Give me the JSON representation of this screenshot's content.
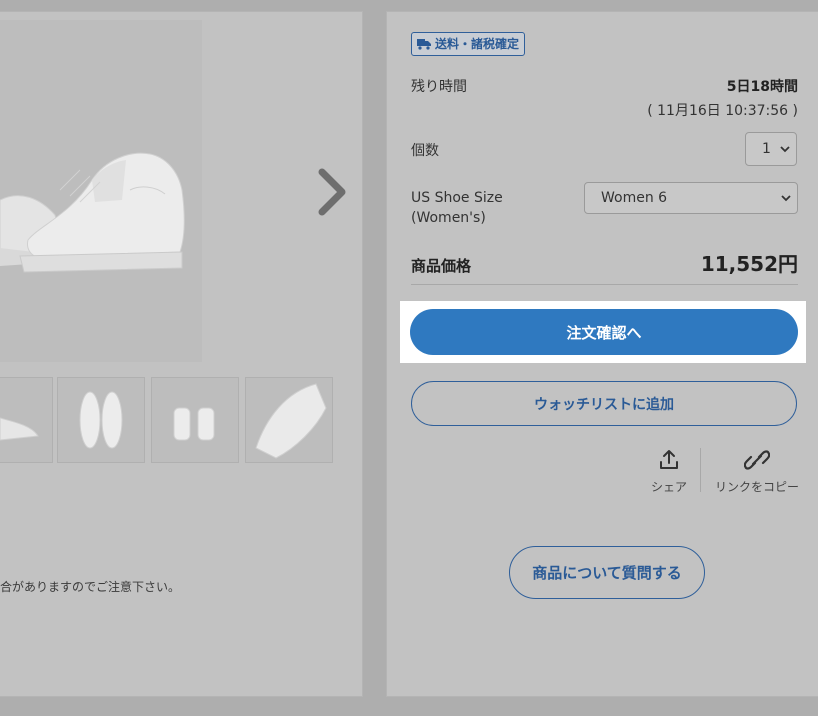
{
  "left": {
    "notice_text": "合がありますのでご注意下さい。"
  },
  "badge": {
    "label": "送料・諸税確定",
    "icon": "truck-icon"
  },
  "remaining": {
    "label": "残り時間",
    "value": "5日18時間",
    "deadline": "( 11月16日 10:37:56 )"
  },
  "quantity": {
    "label": "個数",
    "selected": "1"
  },
  "size": {
    "label": "US Shoe Size (Women's)",
    "selected": "Women 6"
  },
  "price": {
    "label": "商品価格",
    "value": "11,552円"
  },
  "buttons": {
    "checkout": "注文確認へ",
    "watchlist": "ウォッチリストに追加",
    "question": "商品について質問する"
  },
  "actions": {
    "share": "シェア",
    "copy_link": "リンクをコピー"
  },
  "colors": {
    "accent": "#2f79c0",
    "outline": "#2f5f9a"
  }
}
